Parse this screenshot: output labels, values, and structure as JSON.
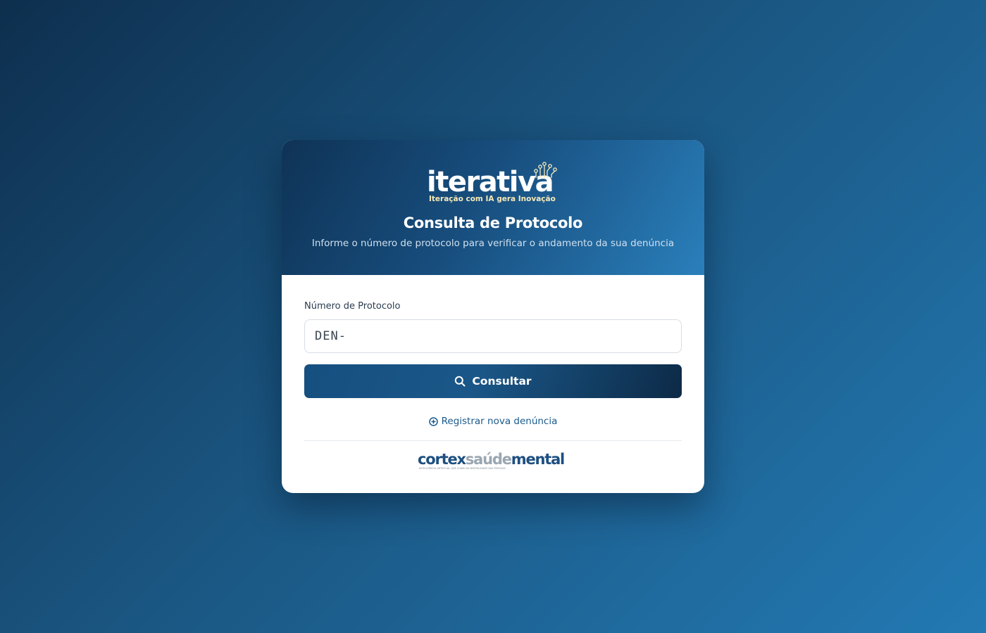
{
  "brand": {
    "name": "iterativa",
    "tagline": "Iteração com IA gera Inovação"
  },
  "header": {
    "title": "Consulta de Protocolo",
    "subtitle": "Informe o número de protocolo para verificar o andamento da sua denúncia"
  },
  "form": {
    "label": "Número de Protocolo",
    "value": "DEN-",
    "placeholder": "DEN-",
    "submit_label": "Consultar",
    "submit_icon": "search-icon"
  },
  "links": {
    "new_report": "Registrar nova denúncia",
    "new_report_icon": "plus-circle-icon"
  },
  "footer": {
    "logo_part1": "cortex",
    "logo_part2": "saúde",
    "logo_part3": "mental",
    "logo_tagline": "INTELIGÊNCIA ARTIFICIAL QUE CUIDA DA MENTALIDADE DAS PESSOAS"
  },
  "colors": {
    "background_dark": "#0e2f4e",
    "background_light": "#2379b3",
    "button": "#164f80",
    "link": "#1a5a8c",
    "tagline": "#f6e9b8"
  }
}
